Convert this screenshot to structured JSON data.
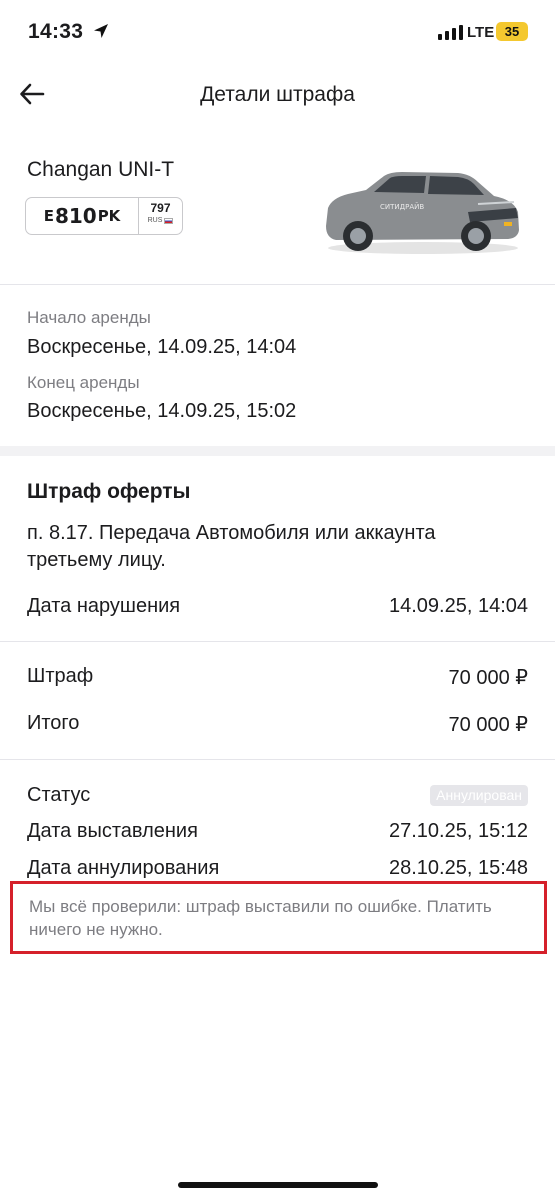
{
  "status_bar": {
    "time": "14:33",
    "network": "LTE",
    "battery": "35",
    "icons": [
      "location-arrow-icon",
      "signal-bars-icon"
    ]
  },
  "header": {
    "title": "Детали штрафа",
    "back_icon": "arrow-left-icon"
  },
  "car": {
    "name": "Changan UNI-T",
    "plate": {
      "letter1": "E",
      "number": "810",
      "letters2": "PK",
      "region": "797",
      "country": "RUS"
    },
    "image_text": "СИТИДРАЙВ",
    "colors": {
      "body": "#8a8d90",
      "accent": "#f0b323"
    }
  },
  "rental": {
    "start_label": "Начало аренды",
    "start_value": "Воскресенье, 14.09.25, 14:04",
    "end_label": "Конец аренды",
    "end_value": "Воскресенье, 14.09.25, 15:02"
  },
  "fine": {
    "title": "Штраф оферты",
    "rule": "п. 8.17. Передача Автомобиля или аккаунта третьему лицу.",
    "violation_date_label": "Дата нарушения",
    "violation_date_value": "14.09.25, 14:04"
  },
  "amounts": {
    "fine_label": "Штраф",
    "fine_value": "70 000 ₽",
    "total_label": "Итого",
    "total_value": "70 000 ₽"
  },
  "status": {
    "label": "Статус",
    "badge": "Аннулирован",
    "issued_label": "Дата выставления",
    "issued_value": "27.10.25, 15:12",
    "annulled_label": "Дата аннулирования",
    "annulled_value": "28.10.25, 15:48"
  },
  "notice": {
    "text": "Мы всё проверили: штраф выставили по ошибке. Платить ничего не нужно.",
    "highlight_color": "#d5202a"
  }
}
